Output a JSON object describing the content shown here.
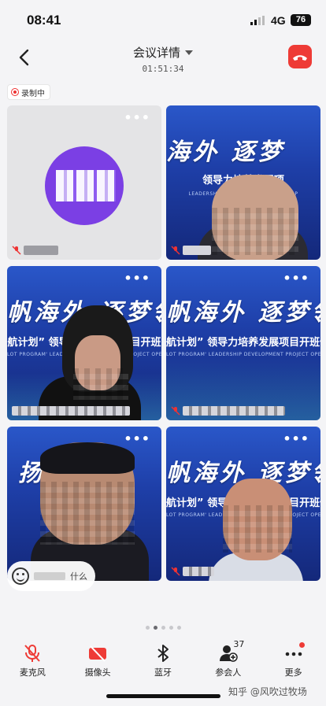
{
  "status_bar": {
    "time": "08:41",
    "network": "4G",
    "battery": "76"
  },
  "header": {
    "title": "会议详情",
    "duration": "01:51:34"
  },
  "recording": {
    "label": "录制中"
  },
  "tiles": [
    {
      "kind": "avatar",
      "more": "•••"
    },
    {
      "kind": "video",
      "banner": "海外  逐梦",
      "sub": "领导力培养发展项",
      "sub2": "LEADERSHIP DEVELOPMENT PROJECT OP",
      "more": ""
    },
    {
      "kind": "video",
      "banner": "帆海外  逐梦领",
      "sub": "航计划”  领导力培养发展项目开班",
      "sub2": "LOT PROGRAM' LEADERSHIP DEVELOPMENT PROJECT OPENING CEREMONY",
      "more": "•••"
    },
    {
      "kind": "video",
      "banner": "帆海外  逐梦领",
      "sub": "航计划”  领导力培养发展项目开班仪",
      "sub2": "LOT PROGRAM' LEADERSHIP DEVELOPMENT PROJECT OPENING CEREMONY",
      "more": "•••"
    },
    {
      "kind": "video",
      "banner": "扬      外",
      "sub": "",
      "sub2": "",
      "more": "•••"
    },
    {
      "kind": "video",
      "banner": "帆海外  逐梦领",
      "sub": "航计划”  领导力培养发展项目开班仪",
      "sub2": "LOT PROGRAM' LEADERSHIP DEVELOPMENT PROJECT OPENING CEREMONY",
      "more": "•••"
    }
  ],
  "chat": {
    "text": "什么"
  },
  "toolbar": {
    "mic": "麦克风",
    "camera": "摄像头",
    "bluetooth": "蓝牙",
    "participants": "参会人",
    "participants_count": "37",
    "more": "更多"
  },
  "watermark": "知乎 @风吹过牧场",
  "colors": {
    "accent_red": "#ee3b36",
    "banner_blue": "#1e3fa8",
    "avatar_purple": "#7b3fe4"
  }
}
